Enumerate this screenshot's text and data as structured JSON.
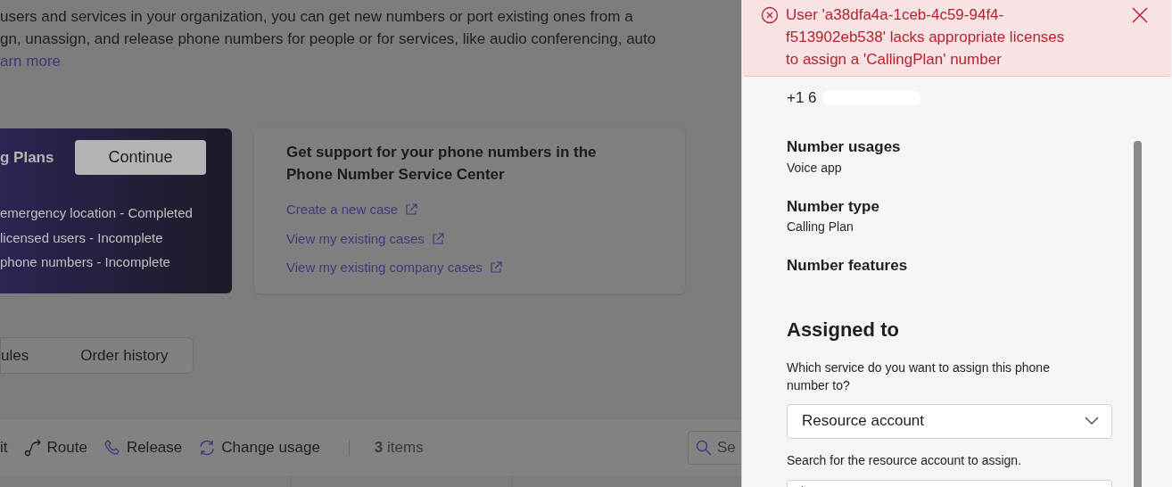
{
  "intro": {
    "lines": [
      "users and services in your organization, you can get new numbers or port existing ones from a",
      "gn, unassign, and release phone numbers for people or for services, like audio conferencing, auto"
    ],
    "link": "arn more"
  },
  "setup_card": {
    "title": "g Plans",
    "button": "Continue",
    "steps": [
      "emergency location - Completed",
      "licensed users - Incomplete",
      "phone numbers - Incomplete"
    ]
  },
  "support_card": {
    "title": "Get support for your phone numbers in the Phone Number Service Center",
    "links": [
      "Create a new case",
      "View my existing cases",
      "View my existing company cases"
    ]
  },
  "tabs": [
    {
      "label": "ules",
      "selected": false
    },
    {
      "label": "Order history",
      "selected": false
    }
  ],
  "toolbar": {
    "items": [
      {
        "kind": "text",
        "label": "it"
      },
      {
        "kind": "route",
        "label": "Route"
      },
      {
        "kind": "phone",
        "label": "Release"
      },
      {
        "kind": "refresh",
        "label": "Change usage"
      }
    ],
    "count_number": "3",
    "count_label": "items",
    "search_placeholder": "Se"
  },
  "panel": {
    "error": "User 'a38dfa4a-1ceb-4c59-94f4-f513902eb538' lacks appropriate licenses to assign a 'CallingPlan' number",
    "phone_number": "+1 6",
    "details": [
      {
        "label": "Number usages",
        "value": "Voice app"
      },
      {
        "label": "Number type",
        "value": "Calling Plan"
      },
      {
        "label": "Number features"
      }
    ],
    "assigned_heading": "Assigned to",
    "question": "Which service do you want to assign this phone number to?",
    "dropdown_value": "Resource account",
    "search_label": "Search for the resource account to assign."
  }
}
